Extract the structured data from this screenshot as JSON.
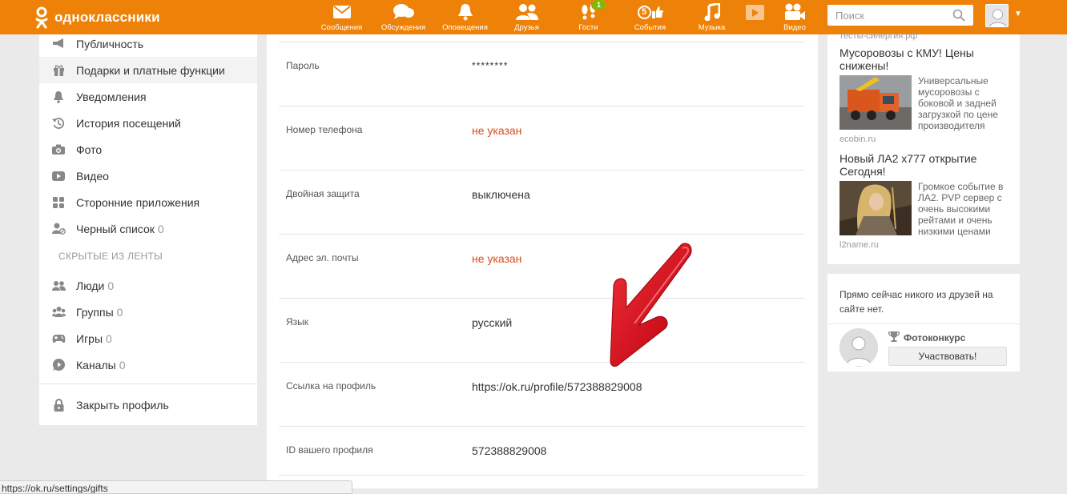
{
  "header": {
    "logo_text": "одноклассники",
    "nav": [
      {
        "label": "Сообщения",
        "icon": "envelope-icon"
      },
      {
        "label": "Обсуждения",
        "icon": "chat-bubbles-icon"
      },
      {
        "label": "Оповещения",
        "icon": "bell-icon"
      },
      {
        "label": "Друзья",
        "icon": "friends-icon"
      },
      {
        "label": "Гости",
        "icon": "footprints-icon",
        "badge": "1"
      },
      {
        "label": "События",
        "icon": "thumbs-up-icon",
        "badge": "5"
      },
      {
        "label": "Музыка",
        "icon": "music-note-icon"
      },
      {
        "label": "Видео",
        "icon": "video-camera-icon"
      }
    ],
    "search_placeholder": "Поиск",
    "colors": {
      "brand": "#ee8208",
      "badge": "#7fb900",
      "warn": "#d94a1e"
    }
  },
  "left_menu": {
    "items": [
      {
        "label": "Публичность",
        "icon": "megaphone-icon"
      },
      {
        "label": "Подарки и платные функции",
        "icon": "gift-icon",
        "active": true
      },
      {
        "label": "Уведомления",
        "icon": "bell-icon"
      },
      {
        "label": "История посещений",
        "icon": "history-icon"
      },
      {
        "label": "Фото",
        "icon": "camera-icon"
      },
      {
        "label": "Видео",
        "icon": "play-icon"
      },
      {
        "label": "Сторонние приложения",
        "icon": "apps-grid-icon"
      },
      {
        "label": "Черный список",
        "icon": "blocked-user-icon",
        "count": "0"
      }
    ],
    "hidden_section_title": "СКРЫТЫЕ ИЗ ЛЕНТЫ",
    "hidden_items": [
      {
        "label": "Люди",
        "icon": "people-icon",
        "count": "0"
      },
      {
        "label": "Группы",
        "icon": "groups-icon",
        "count": "0"
      },
      {
        "label": "Игры",
        "icon": "gamepad-icon",
        "count": "0"
      },
      {
        "label": "Каналы",
        "icon": "channel-play-icon",
        "count": "0"
      }
    ],
    "close_profile": {
      "label": "Закрыть профиль",
      "icon": "lock-icon"
    }
  },
  "settings": [
    {
      "label": "Пароль",
      "value": "********",
      "kind": "password"
    },
    {
      "label": "Номер телефона",
      "value": "не указан",
      "kind": "warn"
    },
    {
      "label": "Двойная защита",
      "value": "выключена",
      "kind": "normal"
    },
    {
      "label": "Адрес эл. почты",
      "value": "не указан",
      "kind": "warn"
    },
    {
      "label": "Язык",
      "value": "русский",
      "kind": "normal"
    },
    {
      "label": "Ссылка на профиль",
      "value": "https://ok.ru/profile/572388829008",
      "kind": "normal"
    },
    {
      "label": "ID вашего профиля",
      "value": "572388829008",
      "kind": "normal"
    }
  ],
  "right": {
    "ad_top_source": "тесты-синергия.рф",
    "ads": [
      {
        "title": "Мусоровозы с КМУ! Цены снижены!",
        "desc": "Универсальные мусоровозы с боковой и задней загрузкой по цене производителя",
        "source": "ecobin.ru",
        "image": "garbage-truck-image"
      },
      {
        "title": "Новый ЛА2 x777 открытие Сегодня!",
        "desc": "Громкое событие в ЛА2. PVP сервер с очень высокими рейтами и очень низкими ценами",
        "source": "l2name.ru",
        "image": "fantasy-warrior-image"
      }
    ],
    "friends_online_text": "Прямо сейчас никого из друзей на сайте нет.",
    "contest_title": "Фотоконкурс",
    "contest_button": "Участвовать!"
  },
  "status_url": "https://ok.ru/settings/gifts"
}
